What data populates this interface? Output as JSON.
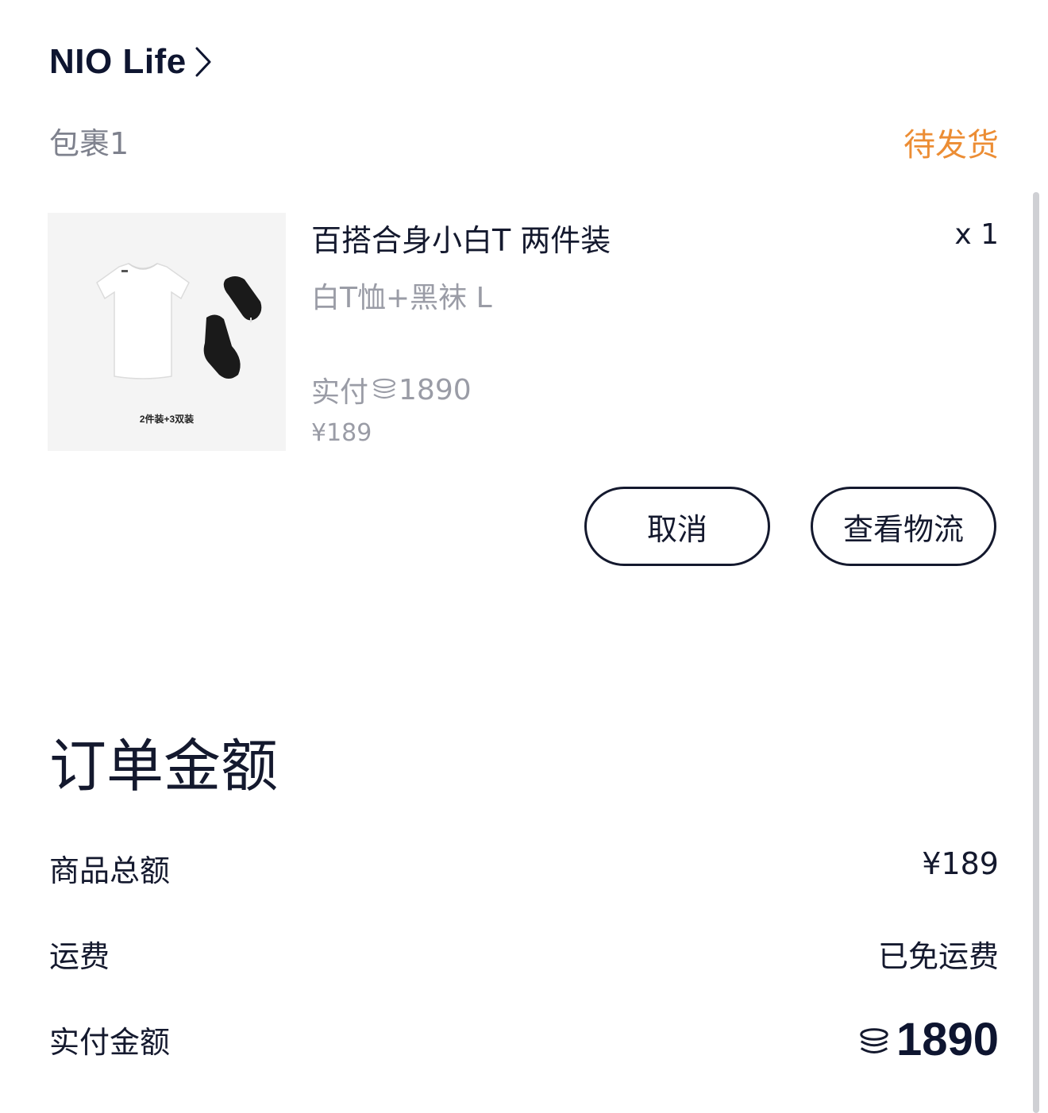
{
  "header": {
    "store_name": "NIO Life"
  },
  "package": {
    "label": "包裹1",
    "status": "待发货",
    "status_color": "#ec8d34"
  },
  "item": {
    "image_caption": "2件装+3双装",
    "title": "百搭合身小白T 两件装",
    "spec": "白T恤+黑袜 L",
    "quantity": "x 1",
    "paid_prefix": "实付",
    "paid_points": "1890",
    "price": "¥189"
  },
  "actions": {
    "cancel": "取消",
    "logistics": "查看物流"
  },
  "summary": {
    "title": "订单金额",
    "rows": [
      {
        "label": "商品总额",
        "value": "¥189"
      },
      {
        "label": "运费",
        "value": "已免运费"
      },
      {
        "label": "实付金额",
        "value": "1890"
      }
    ]
  },
  "icons": {
    "store_chevron": "chevron-right-icon",
    "points": "coin-stack-icon"
  }
}
